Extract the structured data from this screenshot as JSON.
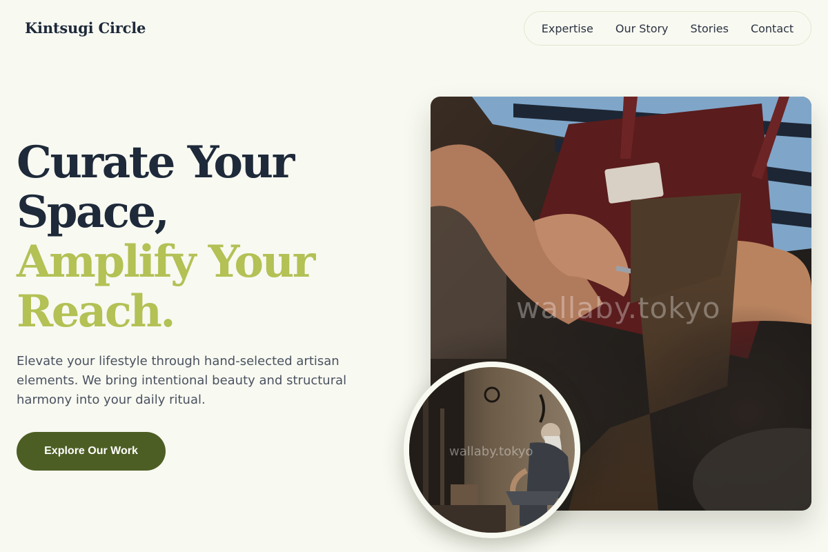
{
  "brand": {
    "name": "Kintsugi Circle"
  },
  "nav": {
    "items": [
      {
        "label": "Expertise"
      },
      {
        "label": "Our Story"
      },
      {
        "label": "Stories"
      },
      {
        "label": "Contact"
      }
    ]
  },
  "hero": {
    "headline_line1": "Curate Your",
    "headline_line2": "Space,",
    "headline_line3": "Amplify Your",
    "headline_line4": "Reach.",
    "lead": "Elevate your lifestyle through hand-selected artisan elements. We bring intentional beauty and structural harmony into your daily ritual.",
    "cta_label": "Explore Our Work",
    "main_image_watermark": "wallaby.tokyo",
    "inset_image_watermark": "wallaby.tokyo"
  },
  "colors": {
    "background": "#f8f9f1",
    "text_dark": "#1e2a3a",
    "accent_green": "#b3c155",
    "button_green": "#4d5e24"
  }
}
